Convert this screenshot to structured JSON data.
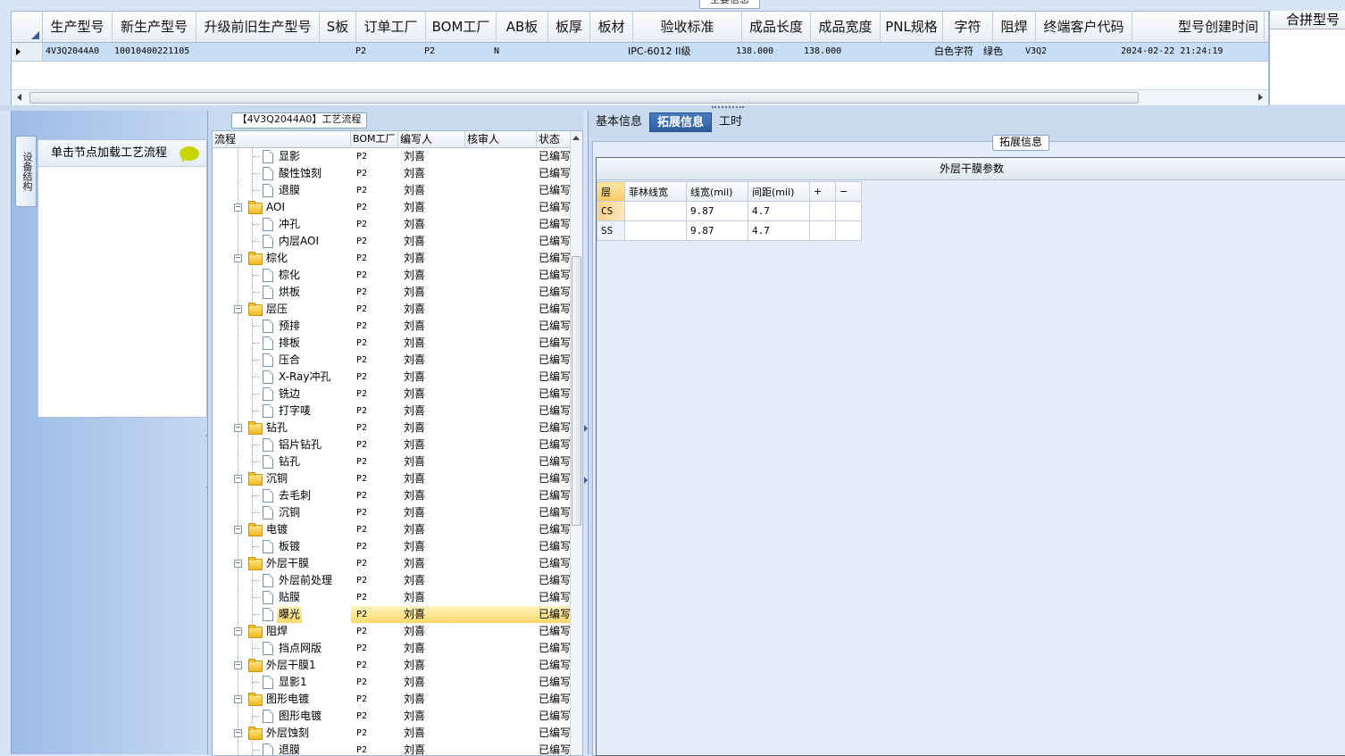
{
  "top_section": {
    "title": "主要信息",
    "columns": [
      "生产型号",
      "新生产型号",
      "升级前旧生产型号",
      "S板",
      "订单工厂",
      "BOM工厂",
      "AB板",
      "板厚",
      "板材",
      "验收标准",
      "成品长度",
      "成品宽度",
      "PNL规格",
      "字符",
      "阻焊",
      "终端客户代码",
      "型号创建时间"
    ],
    "row": [
      "4V3Q2044A0",
      "10010400221105",
      "",
      "",
      "P2",
      "P2",
      "N",
      "",
      "",
      "IPC-6012 II级",
      "138.000",
      "138.000",
      "",
      "白色字符",
      "绿色",
      "V3Q2",
      "2024-02-22 21:24:19"
    ],
    "side_header": "合拼型号"
  },
  "left_rail": {
    "tab_label": "设备结构",
    "hint": "单击节点加载工艺流程"
  },
  "process_tree": {
    "title": "【4V3Q2044A0】工艺流程",
    "columns": [
      "流程",
      "BOM工厂",
      "编写人",
      "核审人",
      "状态"
    ],
    "rows": [
      {
        "level": 1,
        "type": "doc",
        "name": "显影",
        "bom": "P2",
        "writer": "刘喜",
        "reviewer": "",
        "status": "已编写"
      },
      {
        "level": 1,
        "type": "doc",
        "name": "酸性蚀刻",
        "bom": "P2",
        "writer": "刘喜",
        "reviewer": "",
        "status": "已编写"
      },
      {
        "level": 1,
        "type": "doc",
        "name": "退膜",
        "bom": "P2",
        "writer": "刘喜",
        "reviewer": "",
        "status": "已编写"
      },
      {
        "level": 0,
        "type": "folder",
        "name": "AOI",
        "bom": "P2",
        "writer": "刘喜",
        "reviewer": "",
        "status": "已编写"
      },
      {
        "level": 1,
        "type": "doc",
        "name": "冲孔",
        "bom": "P2",
        "writer": "刘喜",
        "reviewer": "",
        "status": "已编写"
      },
      {
        "level": 1,
        "type": "doc",
        "name": "内层AOI",
        "bom": "P2",
        "writer": "刘喜",
        "reviewer": "",
        "status": "已编写"
      },
      {
        "level": 0,
        "type": "folder",
        "name": "棕化",
        "bom": "P2",
        "writer": "刘喜",
        "reviewer": "",
        "status": "已编写"
      },
      {
        "level": 1,
        "type": "doc",
        "name": "棕化",
        "bom": "P2",
        "writer": "刘喜",
        "reviewer": "",
        "status": "已编写"
      },
      {
        "level": 1,
        "type": "doc",
        "name": "烘板",
        "bom": "P2",
        "writer": "刘喜",
        "reviewer": "",
        "status": "已编写"
      },
      {
        "level": 0,
        "type": "folder",
        "name": "层压",
        "bom": "P2",
        "writer": "刘喜",
        "reviewer": "",
        "status": "已编写"
      },
      {
        "level": 1,
        "type": "doc",
        "name": "预排",
        "bom": "P2",
        "writer": "刘喜",
        "reviewer": "",
        "status": "已编写"
      },
      {
        "level": 1,
        "type": "doc",
        "name": "排板",
        "bom": "P2",
        "writer": "刘喜",
        "reviewer": "",
        "status": "已编写"
      },
      {
        "level": 1,
        "type": "doc",
        "name": "压合",
        "bom": "P2",
        "writer": "刘喜",
        "reviewer": "",
        "status": "已编写"
      },
      {
        "level": 1,
        "type": "doc",
        "name": "X-Ray冲孔",
        "bom": "P2",
        "writer": "刘喜",
        "reviewer": "",
        "status": "已编写"
      },
      {
        "level": 1,
        "type": "doc",
        "name": "铣边",
        "bom": "P2",
        "writer": "刘喜",
        "reviewer": "",
        "status": "已编写"
      },
      {
        "level": 1,
        "type": "doc",
        "name": "打字唛",
        "bom": "P2",
        "writer": "刘喜",
        "reviewer": "",
        "status": "已编写"
      },
      {
        "level": 0,
        "type": "folder",
        "name": "钻孔",
        "bom": "P2",
        "writer": "刘喜",
        "reviewer": "",
        "status": "已编写"
      },
      {
        "level": 1,
        "type": "doc",
        "name": "铝片钻孔",
        "bom": "P2",
        "writer": "刘喜",
        "reviewer": "",
        "status": "已编写"
      },
      {
        "level": 1,
        "type": "doc",
        "name": "钻孔",
        "bom": "P2",
        "writer": "刘喜",
        "reviewer": "",
        "status": "已编写"
      },
      {
        "level": 0,
        "type": "folder",
        "name": "沉铜",
        "bom": "P2",
        "writer": "刘喜",
        "reviewer": "",
        "status": "已编写"
      },
      {
        "level": 1,
        "type": "doc",
        "name": "去毛刺",
        "bom": "P2",
        "writer": "刘喜",
        "reviewer": "",
        "status": "已编写"
      },
      {
        "level": 1,
        "type": "doc",
        "name": "沉铜",
        "bom": "P2",
        "writer": "刘喜",
        "reviewer": "",
        "status": "已编写"
      },
      {
        "level": 0,
        "type": "folder",
        "name": "电镀",
        "bom": "P2",
        "writer": "刘喜",
        "reviewer": "",
        "status": "已编写"
      },
      {
        "level": 1,
        "type": "doc",
        "name": "板镀",
        "bom": "P2",
        "writer": "刘喜",
        "reviewer": "",
        "status": "已编写"
      },
      {
        "level": 0,
        "type": "folder",
        "name": "外层干膜",
        "bom": "P2",
        "writer": "刘喜",
        "reviewer": "",
        "status": "已编写"
      },
      {
        "level": 1,
        "type": "doc",
        "name": "外层前处理",
        "bom": "P2",
        "writer": "刘喜",
        "reviewer": "",
        "status": "已编写"
      },
      {
        "level": 1,
        "type": "doc",
        "name": "贴膜",
        "bom": "P2",
        "writer": "刘喜",
        "reviewer": "",
        "status": "已编写"
      },
      {
        "level": 1,
        "type": "doc",
        "name": "曝光",
        "bom": "P2",
        "writer": "刘喜",
        "reviewer": "",
        "status": "已编写",
        "selected": true
      },
      {
        "level": 0,
        "type": "folder",
        "name": "阻焊",
        "bom": "P2",
        "writer": "刘喜",
        "reviewer": "",
        "status": "已编写"
      },
      {
        "level": 1,
        "type": "doc",
        "name": "挡点网版",
        "bom": "P2",
        "writer": "刘喜",
        "reviewer": "",
        "status": "已编写"
      },
      {
        "level": 0,
        "type": "folder",
        "name": "外层干膜1",
        "bom": "P2",
        "writer": "刘喜",
        "reviewer": "",
        "status": "已编写"
      },
      {
        "level": 1,
        "type": "doc",
        "name": "显影1",
        "bom": "P2",
        "writer": "刘喜",
        "reviewer": "",
        "status": "已编写"
      },
      {
        "level": 0,
        "type": "folder",
        "name": "图形电镀",
        "bom": "P2",
        "writer": "刘喜",
        "reviewer": "",
        "status": "已编写"
      },
      {
        "level": 1,
        "type": "doc",
        "name": "图形电镀",
        "bom": "P2",
        "writer": "刘喜",
        "reviewer": "",
        "status": "已编写"
      },
      {
        "level": 0,
        "type": "folder",
        "name": "外层蚀刻",
        "bom": "P2",
        "writer": "刘喜",
        "reviewer": "",
        "status": "已编写"
      },
      {
        "level": 1,
        "type": "doc",
        "name": "退膜",
        "bom": "P2",
        "writer": "刘喜",
        "reviewer": "",
        "status": "已编写"
      }
    ]
  },
  "right_panel": {
    "tabs": [
      "基本信息",
      "拓展信息",
      "工时"
    ],
    "active_tab": 1,
    "group_title": "拓展信息",
    "param_title": "外层干膜参数",
    "param_columns": [
      "层",
      "菲林线宽",
      "线宽(mil)",
      "间距(mil)",
      "+",
      "−"
    ],
    "param_rows": [
      [
        "CS",
        "",
        "9.87",
        "4.7",
        "",
        ""
      ],
      [
        "SS",
        "",
        "9.87",
        "4.7",
        "",
        ""
      ]
    ]
  },
  "colors": {
    "accent": "#2c5e9e",
    "selection": "#fcd86a",
    "row_highlight": "#c8def7",
    "panel_bg": "#c9d9ee"
  }
}
